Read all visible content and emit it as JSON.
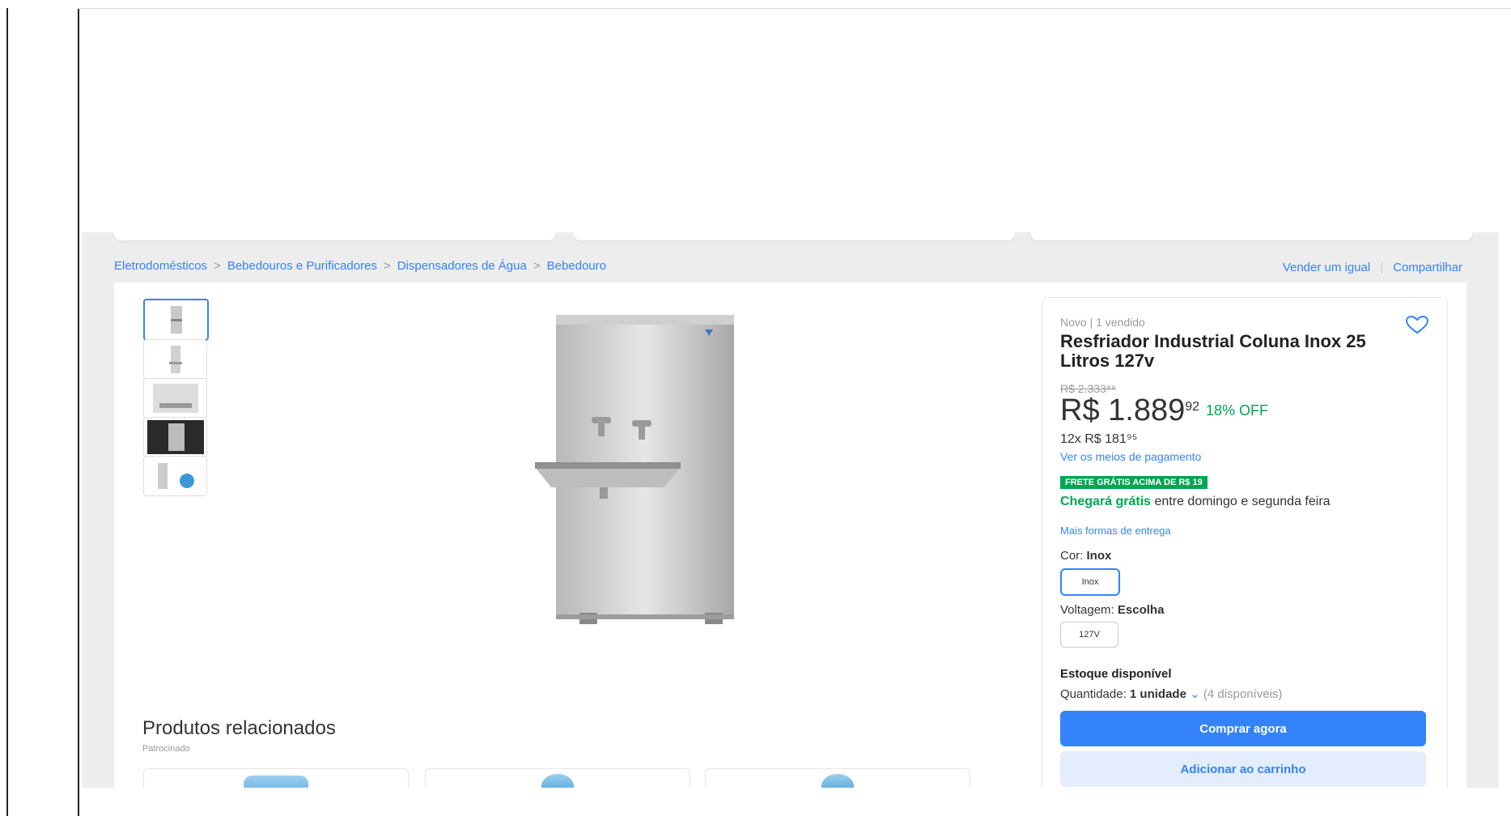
{
  "breadcrumb": [
    {
      "label": "Eletrodomésticos"
    },
    {
      "label": "Bebedouros e Purificadores"
    },
    {
      "label": "Dispensadores de Água"
    },
    {
      "label": "Bebedouro"
    }
  ],
  "breadcrumb_separator": ">",
  "actions": {
    "sell": "Vender um igual",
    "share": "Compartilhar"
  },
  "gallery": {
    "thumbnail_count": 5
  },
  "related": {
    "title": "Produtos relacionados",
    "subtitle": "Patrocinado"
  },
  "buybox": {
    "condition": "Novo | 1 vendido",
    "title": "Resfriador Industrial Coluna Inox 25 Litros 127v",
    "old_price": "R$ 2.333⁸⁸",
    "price": "R$ 1.889",
    "price_cents": "92",
    "discount": "18% OFF",
    "installments": "12x R$ 181⁹⁵",
    "payment_link": "Ver os meios de pagamento",
    "free_shipping_badge": "FRETE GRÁTIS ACIMA DE R$ 19",
    "shipping_strong": "Chegará grátis",
    "shipping_text": "entre domingo e segunda feira",
    "delivery_link": "Mais formas de entrega",
    "color_label": "Cor:",
    "color_value": "Inox",
    "color_option": "Inox",
    "voltage_label": "Voltagem:",
    "voltage_value": "Escolha",
    "voltage_option": "127V",
    "stock_label": "Estoque disponível",
    "qty_label": "Quantidade:",
    "qty_value": "1 unidade",
    "qty_available": "(4 disponíveis)",
    "buy_now": "Comprar agora",
    "add_cart": "Adicionar ao carrinho"
  },
  "colors": {
    "accent": "#3483fa",
    "success": "#00a650",
    "background": "#ededed"
  },
  "icons": {
    "favorite": "heart-outline-icon",
    "qty_dropdown": "chevron-down-icon"
  }
}
